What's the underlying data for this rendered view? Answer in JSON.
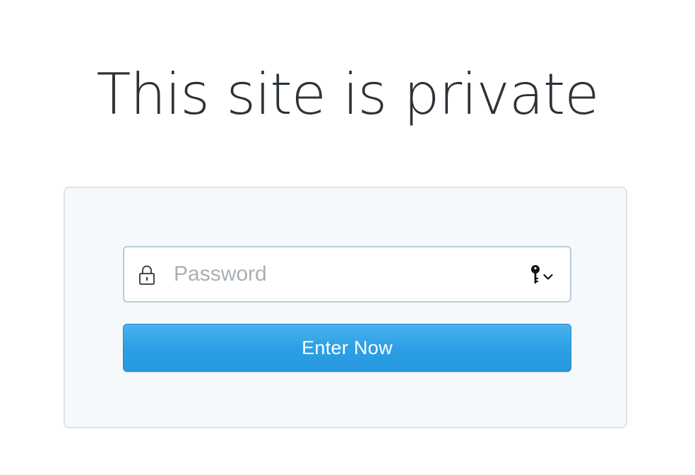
{
  "page": {
    "title": "This site is private"
  },
  "login_form": {
    "password_placeholder": "Password",
    "password_value": "",
    "submit_label": "Enter Now"
  },
  "icons": {
    "field_icon": "lock-icon",
    "autofill_icon": "key-icon",
    "autofill_dropdown_icon": "chevron-down-icon"
  },
  "colors": {
    "title_text": "#2b3238",
    "card_background": "#f6f9fc",
    "card_border": "#dde3e8",
    "field_border": "#b7ccd8",
    "placeholder_text": "#a8b0b6",
    "button_top": "#4ab2ee",
    "button_bottom": "#2598e0",
    "button_text": "#ffffff"
  }
}
